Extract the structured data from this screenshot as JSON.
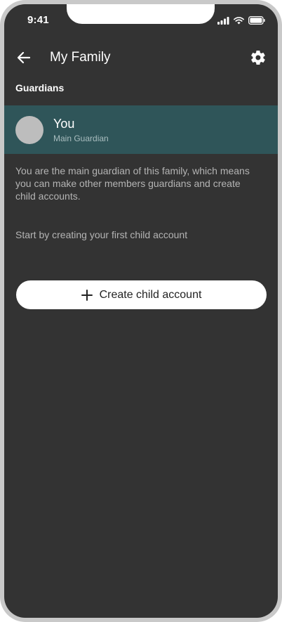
{
  "status_bar": {
    "time": "9:41"
  },
  "header": {
    "title": "My Family"
  },
  "section": {
    "guardians_label": "Guardians"
  },
  "guardian": {
    "name": "You",
    "role": "Main Guardian"
  },
  "info": {
    "description": "You are the main guardian of this family, which means you can make other members guardians and create child accounts.",
    "start_text": "Start by creating your first child account"
  },
  "actions": {
    "create_child_label": "Create child account"
  },
  "colors": {
    "background": "#333333",
    "highlight_row": "#2f5559",
    "avatar": "#bdbdbd",
    "button": "#ffffff"
  },
  "icons": [
    "back-arrow-icon",
    "settings-gear-icon",
    "plus-icon",
    "cellular-signal-icon",
    "wifi-icon",
    "battery-icon"
  ]
}
